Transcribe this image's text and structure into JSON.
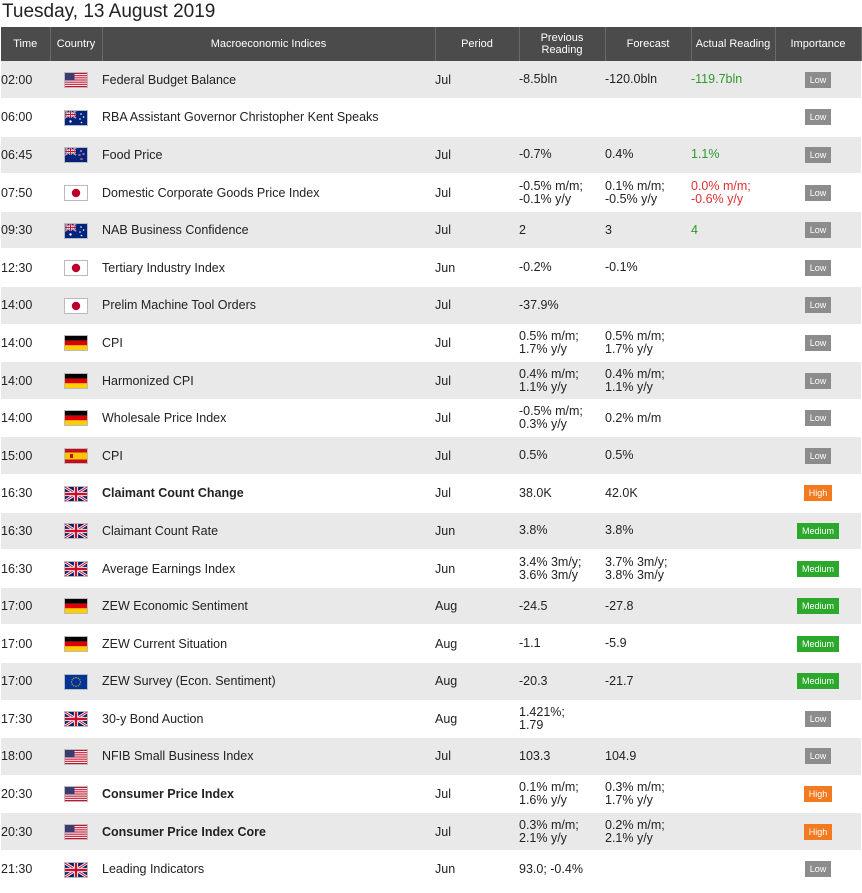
{
  "title": "Tuesday, 13 August 2019",
  "columns": {
    "time": "Time",
    "country": "Country",
    "indices": "Macroeconomic Indices",
    "period": "Period",
    "previous": "Previous Reading",
    "forecast": "Forecast",
    "actual": "Actual Reading",
    "importance": "Importance"
  },
  "colors": {
    "header_bg": "#4b4b4b",
    "row_alt": "#e9e9e9",
    "positive": "#2e9a2e",
    "negative": "#e03030",
    "low": "#8c8c8c",
    "medium": "#2ca82c",
    "high": "#f47a20"
  },
  "rows": [
    {
      "time": "02:00",
      "country": "us-flag-icon",
      "event": "Federal Budget Balance",
      "bold": false,
      "period": "Jul",
      "prev": [
        "-8.5bln"
      ],
      "forecast": [
        "-120.0bln"
      ],
      "actual": [
        "-119.7bln"
      ],
      "actual_color": "pos",
      "importance": "Low"
    },
    {
      "time": "06:00",
      "country": "au-flag-icon",
      "event": "RBA Assistant Governor Christopher Kent Speaks",
      "bold": false,
      "period": "",
      "prev": [],
      "forecast": [],
      "actual": [],
      "actual_color": "",
      "importance": "Low"
    },
    {
      "time": "06:45",
      "country": "nz-flag-icon",
      "event": "Food Price",
      "bold": false,
      "period": "Jul",
      "prev": [
        "-0.7%"
      ],
      "forecast": [
        "0.4%"
      ],
      "actual": [
        "1.1%"
      ],
      "actual_color": "pos",
      "importance": "Low"
    },
    {
      "time": "07:50",
      "country": "jp-flag-icon",
      "event": "Domestic Corporate Goods Price Index",
      "bold": false,
      "period": "Jul",
      "prev": [
        "-0.5% m/m;",
        "-0.1% y/y"
      ],
      "forecast": [
        "0.1% m/m;",
        "-0.5% y/y"
      ],
      "actual": [
        "0.0% m/m;",
        "-0.6% y/y"
      ],
      "actual_color": "neg",
      "importance": "Low"
    },
    {
      "time": "09:30",
      "country": "au-flag-icon",
      "event": "NAB Business Confidence",
      "bold": false,
      "period": "Jul",
      "prev": [
        "2"
      ],
      "forecast": [
        "3"
      ],
      "actual": [
        "4"
      ],
      "actual_color": "pos",
      "importance": "Low"
    },
    {
      "time": "12:30",
      "country": "jp-flag-icon",
      "event": "Tertiary Industry Index",
      "bold": false,
      "period": "Jun",
      "prev": [
        "-0.2%"
      ],
      "forecast": [
        "-0.1%"
      ],
      "actual": [],
      "actual_color": "",
      "importance": "Low"
    },
    {
      "time": "14:00",
      "country": "jp-flag-icon",
      "event": "Prelim Machine Tool Orders",
      "bold": false,
      "period": "Jul",
      "prev": [
        "-37.9%"
      ],
      "forecast": [],
      "actual": [],
      "actual_color": "",
      "importance": "Low"
    },
    {
      "time": "14:00",
      "country": "de-flag-icon",
      "event": "CPI",
      "bold": false,
      "period": "Jul",
      "prev": [
        "0.5% m/m;",
        "1.7% y/y"
      ],
      "forecast": [
        "0.5% m/m;",
        "1.7% y/y"
      ],
      "actual": [],
      "actual_color": "",
      "importance": "Low"
    },
    {
      "time": "14:00",
      "country": "de-flag-icon",
      "event": "Harmonized CPI",
      "bold": false,
      "period": "Jul",
      "prev": [
        "0.4% m/m;",
        "1.1% y/y"
      ],
      "forecast": [
        "0.4% m/m;",
        "1.1% y/y"
      ],
      "actual": [],
      "actual_color": "",
      "importance": "Low"
    },
    {
      "time": "14:00",
      "country": "de-flag-icon",
      "event": "Wholesale Price Index",
      "bold": false,
      "period": "Jul",
      "prev": [
        "-0.5% m/m;",
        "0.3% y/y"
      ],
      "forecast": [
        "0.2% m/m"
      ],
      "actual": [],
      "actual_color": "",
      "importance": "Low"
    },
    {
      "time": "15:00",
      "country": "es-flag-icon",
      "event": "CPI",
      "bold": false,
      "period": "Jul",
      "prev": [
        "0.5%"
      ],
      "forecast": [
        "0.5%"
      ],
      "actual": [],
      "actual_color": "",
      "importance": "Low"
    },
    {
      "time": "16:30",
      "country": "gb-flag-icon",
      "event": "Claimant Count Change",
      "bold": true,
      "period": "Jul",
      "prev": [
        "38.0K"
      ],
      "forecast": [
        "42.0K"
      ],
      "actual": [],
      "actual_color": "",
      "importance": "High"
    },
    {
      "time": "16:30",
      "country": "gb-flag-icon",
      "event": "Claimant Count Rate",
      "bold": false,
      "period": "Jun",
      "prev": [
        "3.8%"
      ],
      "forecast": [
        "3.8%"
      ],
      "actual": [],
      "actual_color": "",
      "importance": "Medium"
    },
    {
      "time": "16:30",
      "country": "gb-flag-icon",
      "event": "Average Earnings Index",
      "bold": false,
      "period": "Jun",
      "prev": [
        "3.4% 3m/y;",
        "3.6% 3m/y"
      ],
      "forecast": [
        "3.7% 3m/y;",
        "3.8% 3m/y"
      ],
      "actual": [],
      "actual_color": "",
      "importance": "Medium"
    },
    {
      "time": "17:00",
      "country": "de-flag-icon",
      "event": "ZEW Economic Sentiment",
      "bold": false,
      "period": "Aug",
      "prev": [
        "-24.5"
      ],
      "forecast": [
        "-27.8"
      ],
      "actual": [],
      "actual_color": "",
      "importance": "Medium"
    },
    {
      "time": "17:00",
      "country": "de-flag-icon",
      "event": "ZEW Current Situation",
      "bold": false,
      "period": "Aug",
      "prev": [
        "-1.1"
      ],
      "forecast": [
        "-5.9"
      ],
      "actual": [],
      "actual_color": "",
      "importance": "Medium"
    },
    {
      "time": "17:00",
      "country": "eu-flag-icon",
      "event": "ZEW Survey (Econ. Sentiment)",
      "bold": false,
      "period": "Aug",
      "prev": [
        "-20.3"
      ],
      "forecast": [
        "-21.7"
      ],
      "actual": [],
      "actual_color": "",
      "importance": "Medium"
    },
    {
      "time": "17:30",
      "country": "gb-flag-icon",
      "event": "30-y Bond Auction",
      "bold": false,
      "period": "Aug",
      "prev": [
        "1.421%;",
        "1.79"
      ],
      "forecast": [],
      "actual": [],
      "actual_color": "",
      "importance": "Low"
    },
    {
      "time": "18:00",
      "country": "us-flag-icon",
      "event": "NFIB Small Business Index",
      "bold": false,
      "period": "Jul",
      "prev": [
        "103.3"
      ],
      "forecast": [
        "104.9"
      ],
      "actual": [],
      "actual_color": "",
      "importance": "Low"
    },
    {
      "time": "20:30",
      "country": "us-flag-icon",
      "event": "Consumer Price Index",
      "bold": true,
      "period": "Jul",
      "prev": [
        "0.1% m/m;",
        "1.6% y/y"
      ],
      "forecast": [
        "0.3% m/m;",
        "1.7% y/y"
      ],
      "actual": [],
      "actual_color": "",
      "importance": "High"
    },
    {
      "time": "20:30",
      "country": "us-flag-icon",
      "event": "Consumer Price Index Core",
      "bold": true,
      "period": "Jul",
      "prev": [
        "0.3% m/m;",
        "2.1% y/y"
      ],
      "forecast": [
        "0.2% m/m;",
        "2.1% y/y"
      ],
      "actual": [],
      "actual_color": "",
      "importance": "High"
    },
    {
      "time": "21:30",
      "country": "gb-flag-icon",
      "event": "Leading Indicators",
      "bold": false,
      "period": "Jun",
      "prev": [
        "93.0; -0.4%"
      ],
      "forecast": [],
      "actual": [],
      "actual_color": "",
      "importance": "Low"
    }
  ]
}
